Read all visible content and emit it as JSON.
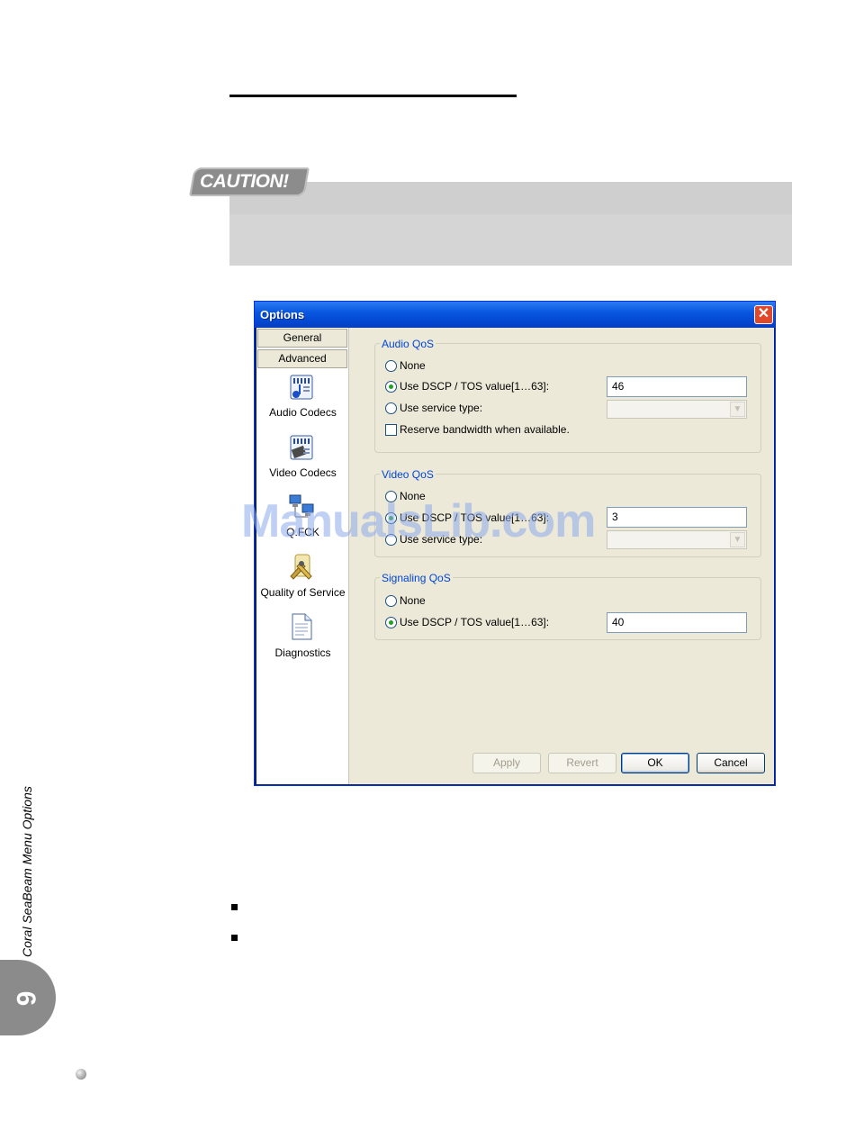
{
  "caution": {
    "label": "CAUTION!"
  },
  "dialog": {
    "title": "Options",
    "close_glyph": "✕",
    "tabs": [
      "General",
      "Advanced"
    ],
    "nav_items": [
      {
        "label": "Audio Codecs",
        "icon": "audio-codecs-icon"
      },
      {
        "label": "Video Codecs",
        "icon": "video-codecs-icon"
      },
      {
        "label": "Q.FCK",
        "icon": "network-icon"
      },
      {
        "label": "Quality of Service",
        "icon": "quality-of-service-icon"
      },
      {
        "label": "Diagnostics",
        "icon": "diagnostics-icon"
      }
    ],
    "audio_qos": {
      "title": "Audio QoS",
      "none_label": "None",
      "dscp_label": "Use DSCP / TOS value[1…63]:",
      "dscp_value": "46",
      "service_label": "Use service type:",
      "reserve_label": "Reserve bandwidth when available."
    },
    "video_qos": {
      "title": "Video QoS",
      "none_label": "None",
      "dscp_label": "Use DSCP / TOS value[1…63]:",
      "dscp_value": "3",
      "service_label": "Use service type:"
    },
    "signaling_qos": {
      "title": "Signaling QoS",
      "none_label": "None",
      "dscp_label": "Use DSCP / TOS value[1…63]:",
      "dscp_value": "40"
    },
    "buttons": {
      "apply": "Apply",
      "revert": "Revert",
      "ok": "OK",
      "cancel": "Cancel"
    }
  },
  "watermark": "ManualsLib.com",
  "side": {
    "section_label": "Coral SeaBeam Menu Options",
    "chapter": "6"
  }
}
